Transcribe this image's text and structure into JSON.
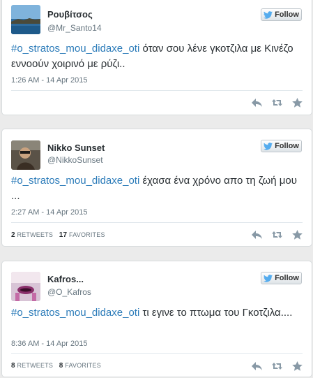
{
  "tweets": [
    {
      "name": "Ρουβίτσος",
      "handle": "@Mr_Santo14",
      "follow_label": "Follow",
      "hashtag": "#o_stratos_mou_didaxe_oti",
      "text": " όταν σου λένε γκοτζιλα με Κινέζο εννοούν χοιρινό με ρύζι..",
      "date": "1:26 AM - 14 Apr 2015"
    },
    {
      "name": "Nikko Sunset",
      "handle": "@NikkoSunset",
      "follow_label": "Follow",
      "hashtag": "#o_stratos_mou_didaxe_oti",
      "text": " έχασα ένα χρόνο απο τη ζωή μου ...",
      "date": "2:27 AM - 14 Apr 2015",
      "retweets": "2",
      "retweets_label": "RETWEETS",
      "favorites": "17",
      "favorites_label": "FAVORITES"
    },
    {
      "name": "Kafros...",
      "handle": "@O_Kafros",
      "follow_label": "Follow",
      "hashtag": "#o_stratos_mou_didaxe_oti",
      "text": " τι εγινε το πτωμα του Γκοτζιλα....",
      "date": "8:36 AM - 14 Apr 2015",
      "retweets": "8",
      "retweets_label": "RETWEETS",
      "favorites": "8",
      "favorites_label": "FAVORITES"
    }
  ],
  "icons": {
    "follow": "twitter-bird-icon",
    "reply": "reply-icon",
    "retweet": "retweet-icon",
    "favorite": "star-icon"
  },
  "colors": {
    "hashtag": "#2b7bb9",
    "twitter_blue": "#55acee",
    "action_icon": "#8899a6"
  }
}
